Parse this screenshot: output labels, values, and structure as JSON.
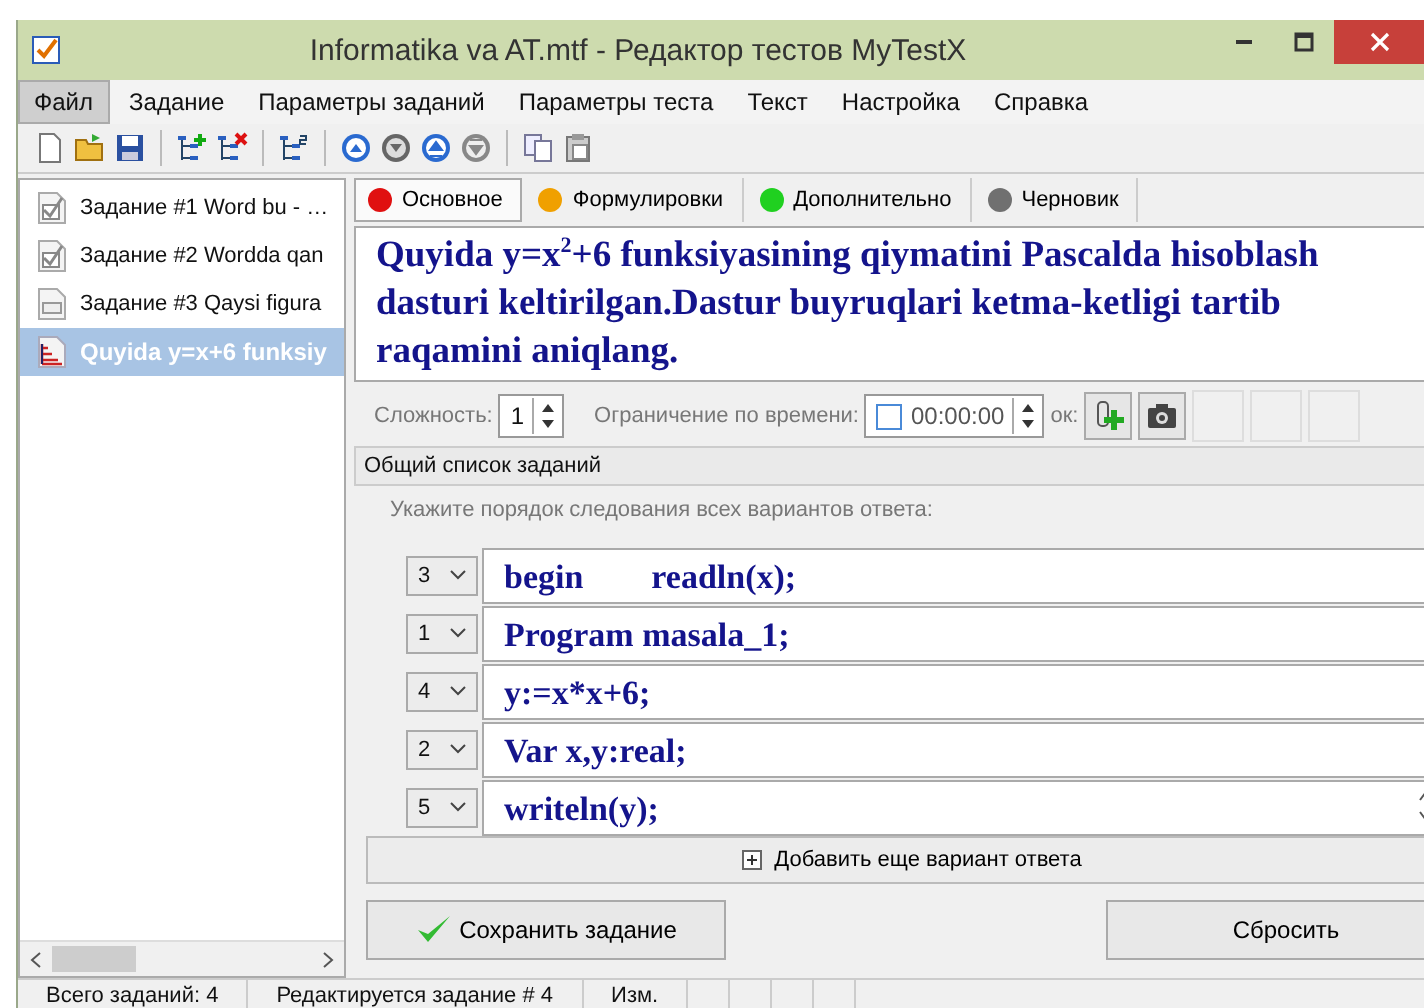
{
  "window": {
    "title": "Informatika va AT.mtf - Редактор тестов MyTestX"
  },
  "menu": [
    {
      "label": "Файл",
      "selected": true
    },
    {
      "label": "Задание",
      "selected": false
    },
    {
      "label": "Параметры заданий",
      "selected": false
    },
    {
      "label": "Параметры теста",
      "selected": false
    },
    {
      "label": "Текст",
      "selected": false
    },
    {
      "label": "Настройка",
      "selected": false
    },
    {
      "label": "Справка",
      "selected": false
    }
  ],
  "tasks": [
    {
      "kind": "check",
      "label": "Задание #1 Word bu - …",
      "selected": false
    },
    {
      "kind": "check",
      "label": "Задание #2 Wordda qan",
      "selected": false
    },
    {
      "kind": "form",
      "label": "Задание #3 Qaysi figura",
      "selected": false
    },
    {
      "kind": "order",
      "label": "Quyida y=x+6 funksiy",
      "selected": true
    }
  ],
  "tabs": [
    {
      "label": "Основное",
      "color": "#e01010",
      "selected": true
    },
    {
      "label": "Формулировки",
      "color": "#f0a000",
      "selected": false
    },
    {
      "label": "Дополнительно",
      "color": "#20d020",
      "selected": false
    },
    {
      "label": "Черновик",
      "color": "#707070",
      "selected": false
    }
  ],
  "question": "Quyida y=x$^{2}$+6 funksiyasining qiymatini Pascalda hisoblash dasturi keltirilgan.Dastur buyruqlari ketma-ketligi tartib raqamini aniqlang.",
  "difficulty": {
    "label": "Сложность:",
    "value": "1"
  },
  "time_limit": {
    "label": "Ограничение по времени:",
    "checked": false,
    "value": "00:00:00"
  },
  "picture_label": "ок:",
  "list_type": "Общий список заданий",
  "instruction": "Укажите порядок следования всех вариантов ответа:",
  "answers": [
    {
      "order": "3",
      "text": "begin        readln(x);"
    },
    {
      "order": "1",
      "text": "Program masala_1;"
    },
    {
      "order": "4",
      "text": "y:=x*x+6;"
    },
    {
      "order": "2",
      "text": "Var x,y:real;"
    },
    {
      "order": "5",
      "text": "writeln(y);"
    }
  ],
  "add_answer": "Добавить еще вариант ответа",
  "buttons": {
    "save": "Сохранить задание",
    "reset": "Сбросить"
  },
  "status_bar": [
    "Всего заданий: 4",
    "Редактируется задание # 4",
    "Изм."
  ]
}
